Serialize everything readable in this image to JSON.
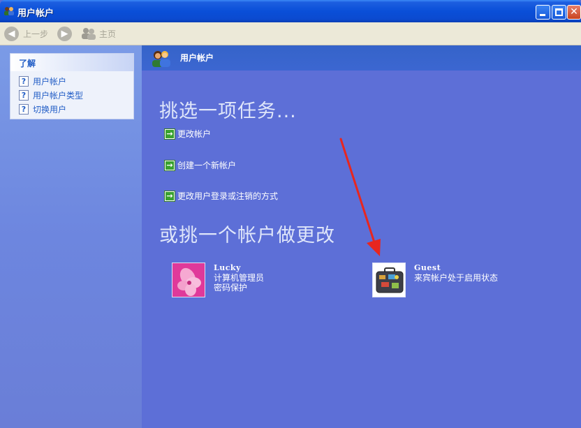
{
  "window": {
    "title": "用户帐户",
    "close_glyph": "✕"
  },
  "toolbar": {
    "back_label": "上一步",
    "home_label": "主页"
  },
  "learn": {
    "header": "了解",
    "items": [
      {
        "label": "用户帐户",
        "icon": "help-icon"
      },
      {
        "label": "用户帐户类型",
        "icon": "help-icon"
      },
      {
        "label": "切换用户",
        "icon": "help-icon"
      }
    ]
  },
  "main": {
    "header_title": "用户帐户",
    "task_heading": "挑选一项任务...",
    "tasks": [
      {
        "label": "更改帐户"
      },
      {
        "label": "创建一个新帐户"
      },
      {
        "label": "更改用户登录或注销的方式"
      }
    ],
    "account_heading": "或挑一个帐户做更改",
    "accounts": [
      {
        "name": "Lucky",
        "line1": "计算机管理员",
        "line2": "密码保护",
        "picture": "pink-flower"
      },
      {
        "name": "Guest",
        "line1": "来宾帐户处于启用状态",
        "line2": "",
        "picture": "suitcase"
      }
    ]
  },
  "colors": {
    "titlebar": "#0a4fd8",
    "left_pane": "#7b9be6",
    "main_bg": "#5d6fd7",
    "link_blue": "#215dc6",
    "annotation_arrow": "#e8261f"
  }
}
